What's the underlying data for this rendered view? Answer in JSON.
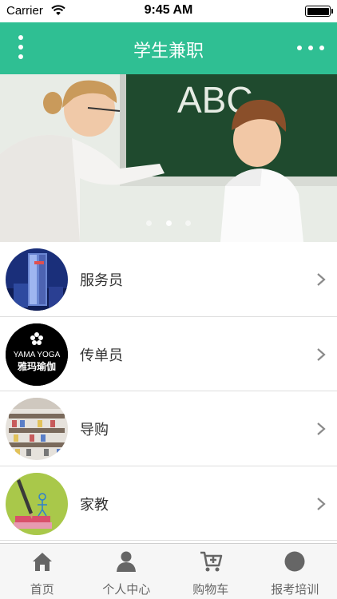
{
  "status_bar": {
    "carrier": "Carrier",
    "time": "9:45 AM"
  },
  "header": {
    "title": "学生兼职",
    "left_icon": "vertical-dots-menu-icon",
    "right_icon": "more-horizontal-icon"
  },
  "banner": {
    "chalkboard_text": "ABC",
    "slide_count": 3,
    "active_slide": 2
  },
  "list": {
    "items": [
      {
        "label": "服务员",
        "thumb": "hotel-building"
      },
      {
        "label": "传单员",
        "thumb_text_1": "YAMA YOGA",
        "thumb_text_2": "雅玛瑜伽"
      },
      {
        "label": "导购",
        "thumb": "store-shelves"
      },
      {
        "label": "家教",
        "thumb": "pencil-book-figure"
      }
    ]
  },
  "tabbar": {
    "tabs": [
      {
        "label": "首页",
        "icon": "home-icon"
      },
      {
        "label": "个人中心",
        "icon": "person-icon"
      },
      {
        "label": "购物车",
        "icon": "cart-icon"
      },
      {
        "label": "报考培训",
        "icon": "circle-icon"
      }
    ]
  },
  "colors": {
    "header_bg": "#2fbf93",
    "tab_icon": "#666666"
  }
}
